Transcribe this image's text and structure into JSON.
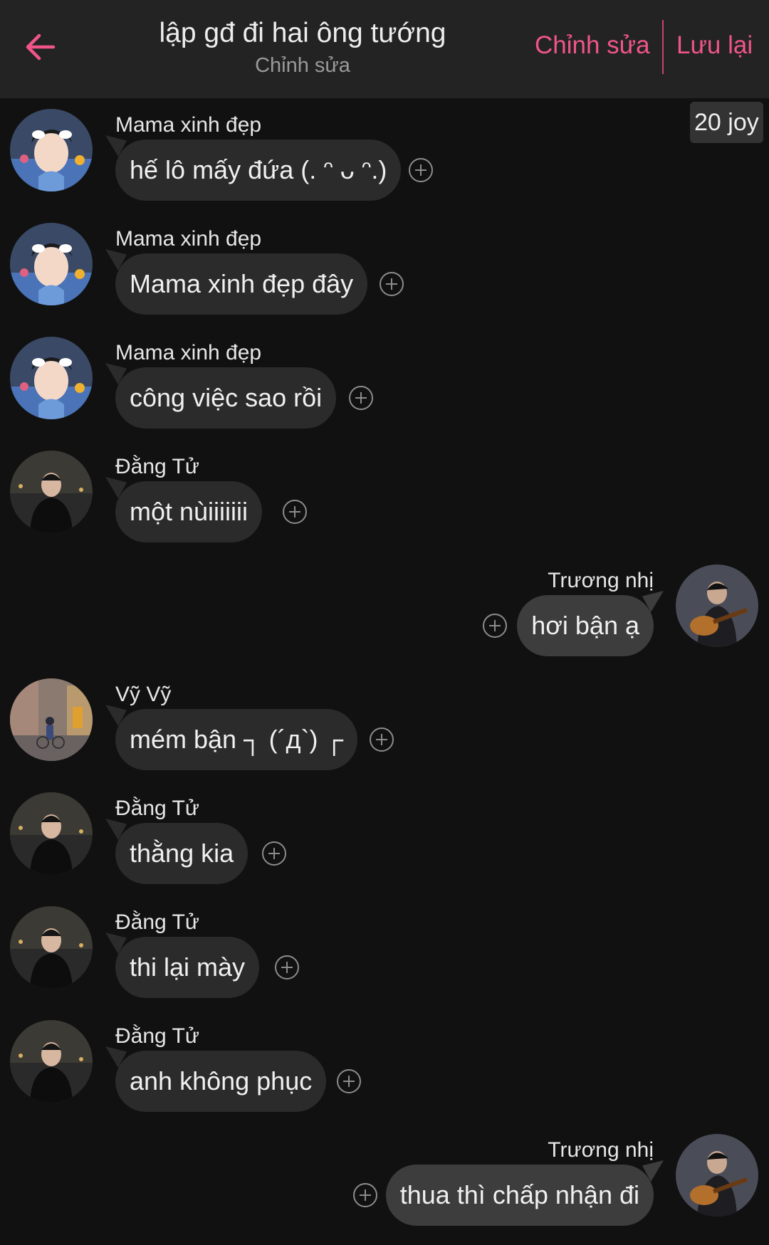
{
  "header": {
    "title": "lập gđ đi hai ông tướng",
    "subtitle": "Chỉnh sửa",
    "edit_label": "Chỉnh sửa",
    "save_label": "Lưu lại",
    "accent_color": "#f0558a"
  },
  "badge": {
    "label": "20 joy"
  },
  "messages": [
    {
      "sender": "Mama xinh đẹp",
      "text": "hế lô mấy đứa (. ᵔ ᴗ ᵔ.)",
      "side": "left",
      "avatar": "mama"
    },
    {
      "sender": "Mama xinh đẹp",
      "text": "Mama xinh đẹp đây",
      "side": "left",
      "avatar": "mama"
    },
    {
      "sender": "Mama xinh đẹp",
      "text": "công việc sao rồi",
      "side": "left",
      "avatar": "mama"
    },
    {
      "sender": "Đằng Tử",
      "text": "một nùiiiiiii",
      "side": "left",
      "avatar": "dang"
    },
    {
      "sender": "Trương nhị",
      "text": "hơi bận ạ",
      "side": "right",
      "avatar": "truong"
    },
    {
      "sender": "Vỹ Vỹ",
      "text": "mém bận ┐ (´д`) ┌",
      "side": "left",
      "avatar": "vy"
    },
    {
      "sender": "Đằng Tử",
      "text": "thằng kia",
      "side": "left",
      "avatar": "dang"
    },
    {
      "sender": "Đằng Tử",
      "text": "thi lại mày",
      "side": "left",
      "avatar": "dang"
    },
    {
      "sender": "Đằng Tử",
      "text": "anh không phục",
      "side": "left",
      "avatar": "dang"
    },
    {
      "sender": "Trương nhị",
      "text": "thua thì chấp nhận đi",
      "side": "right",
      "avatar": "truong"
    }
  ]
}
